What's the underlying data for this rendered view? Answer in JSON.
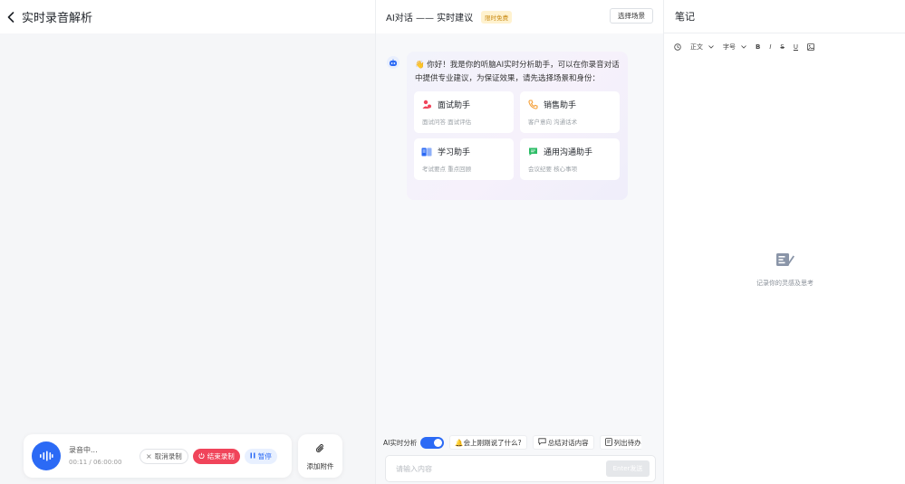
{
  "left": {
    "title": "实时录音解析",
    "recorder": {
      "status": "录音中...",
      "time": "00:11 / 06:00:00",
      "cancel_label": "取消录制",
      "end_label": "结束录制",
      "pause_label": "暂停",
      "end_color": "#f0445a",
      "accent": "#2b6af5"
    },
    "attach_label": "添加附件"
  },
  "middle": {
    "title": "AI对话 —— 实时建议",
    "tag": "限时免费",
    "scene_button": "选择场景",
    "greeting": "你好！我是你的听脑AI实时分析助手，可以在你录音对话中提供专业建议，为保证效果，请先选择场景和身份：",
    "assistants": [
      {
        "name": "面试助手",
        "desc": "面试问答 面试评估",
        "icon": "interview-icon"
      },
      {
        "name": "销售助手",
        "desc": "客户意向 沟通话术",
        "icon": "phone-icon"
      },
      {
        "name": "学习助手",
        "desc": "考试要点 重点回顾",
        "icon": "book-icon"
      },
      {
        "name": "通用沟通助手",
        "desc": "会议纪要 核心事项",
        "icon": "chat-icon"
      }
    ],
    "toolbar": {
      "ai_label": "AI实时分析",
      "chip1": "🔔会上刚刚说了什么?",
      "chip2": "总结对话内容",
      "chip3": "列出待办"
    },
    "input": {
      "placeholder": "请输入内容",
      "send_label": "Enter发送"
    }
  },
  "right": {
    "title": "笔记",
    "toolbar": {
      "text_style": "正文",
      "font_size": "字号",
      "bold": "B",
      "italic": "I",
      "strike": "S",
      "underline": "U"
    },
    "empty_text": "记录你的灵感及思考"
  }
}
